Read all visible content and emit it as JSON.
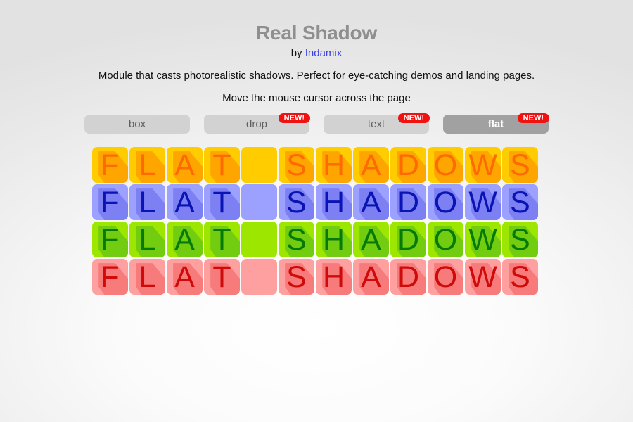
{
  "header": {
    "title": "Real Shadow",
    "by_prefix": "by",
    "author": "Indamix",
    "description": "Module that casts photorealistic shadows. Perfect for eye-catching demos and landing pages.",
    "hint": "Move the mouse cursor across the page"
  },
  "tabs": [
    {
      "label": "box",
      "badge": "",
      "active": false
    },
    {
      "label": "drop",
      "badge": "NEW!",
      "active": false
    },
    {
      "label": "text",
      "badge": "NEW!",
      "active": false
    },
    {
      "label": "flat",
      "badge": "NEW!",
      "active": true
    }
  ],
  "demo": {
    "letters": [
      "F",
      "L",
      "A",
      "T",
      "",
      "S",
      "H",
      "A",
      "D",
      "O",
      "W",
      "S"
    ],
    "rows": [
      {
        "name": "orange",
        "tile": "#ffcc00",
        "shadow": "#ffa500",
        "text": "#ff6a00"
      },
      {
        "name": "blue",
        "tile": "#9ca0ff",
        "shadow": "#7c80f3",
        "text": "#0a14b4"
      },
      {
        "name": "green",
        "tile": "#9ce600",
        "shadow": "#72cc0f",
        "text": "#067a06"
      },
      {
        "name": "red",
        "tile": "#ffa0a0",
        "shadow": "#f77b7b",
        "text": "#cf0a0a"
      }
    ]
  }
}
